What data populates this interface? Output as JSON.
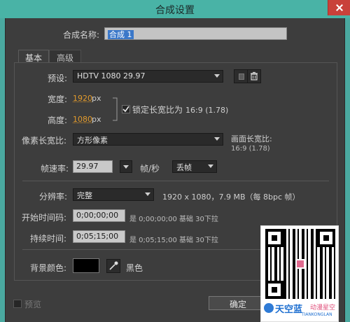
{
  "window": {
    "title": "合成设置"
  },
  "comp_name": {
    "label": "合成名称:",
    "value": "合成 1"
  },
  "tabs": [
    {
      "label": "基本"
    },
    {
      "label": "高级"
    }
  ],
  "preset": {
    "label": "预设:",
    "value": "HDTV 1080 29.97"
  },
  "width": {
    "label": "宽度:",
    "value": "1920",
    "unit": "px"
  },
  "height": {
    "label": "高度:",
    "value": "1080",
    "unit": "px"
  },
  "lock_aspect": {
    "label": "锁定长宽比为",
    "value": "16:9 (1.78)",
    "checked": true
  },
  "pixel_aspect": {
    "label": "像素长宽比:",
    "value": "方形像素"
  },
  "frame_aspect": {
    "label": "画面长宽比:",
    "value": "16:9 (1.78)"
  },
  "frame_rate": {
    "label": "帧速率:",
    "value": "29.97",
    "unit": "帧/秒",
    "mode": "丢帧"
  },
  "resolution": {
    "label": "分辨率:",
    "value": "完整",
    "info": "1920 x 1080，7.9 MB（每 8bpc 帧）"
  },
  "start_timecode": {
    "label": "开始时间码:",
    "value": "0;00;00;00",
    "info": "是 0;00;00;00  基础 30下拉"
  },
  "duration": {
    "label": "持续时间:",
    "value": "0;05;15;00",
    "info": "是 0;05;15;00  基础 30下拉"
  },
  "background": {
    "label": "背景颜色:",
    "color_name": "黑色",
    "color": "#000000"
  },
  "footer": {
    "preview_label": "预览",
    "ok_label": "确定"
  },
  "watermark": {
    "brand_cn": "天空蓝",
    "brand_sub": "动漫星空",
    "brand_en": "TIANKONGLAN"
  },
  "colors": {
    "accent": "#e39b2c",
    "titlebar": "#49b3a6",
    "dialog_bg": "#3d3d3d",
    "selection": "#3b78c9"
  }
}
